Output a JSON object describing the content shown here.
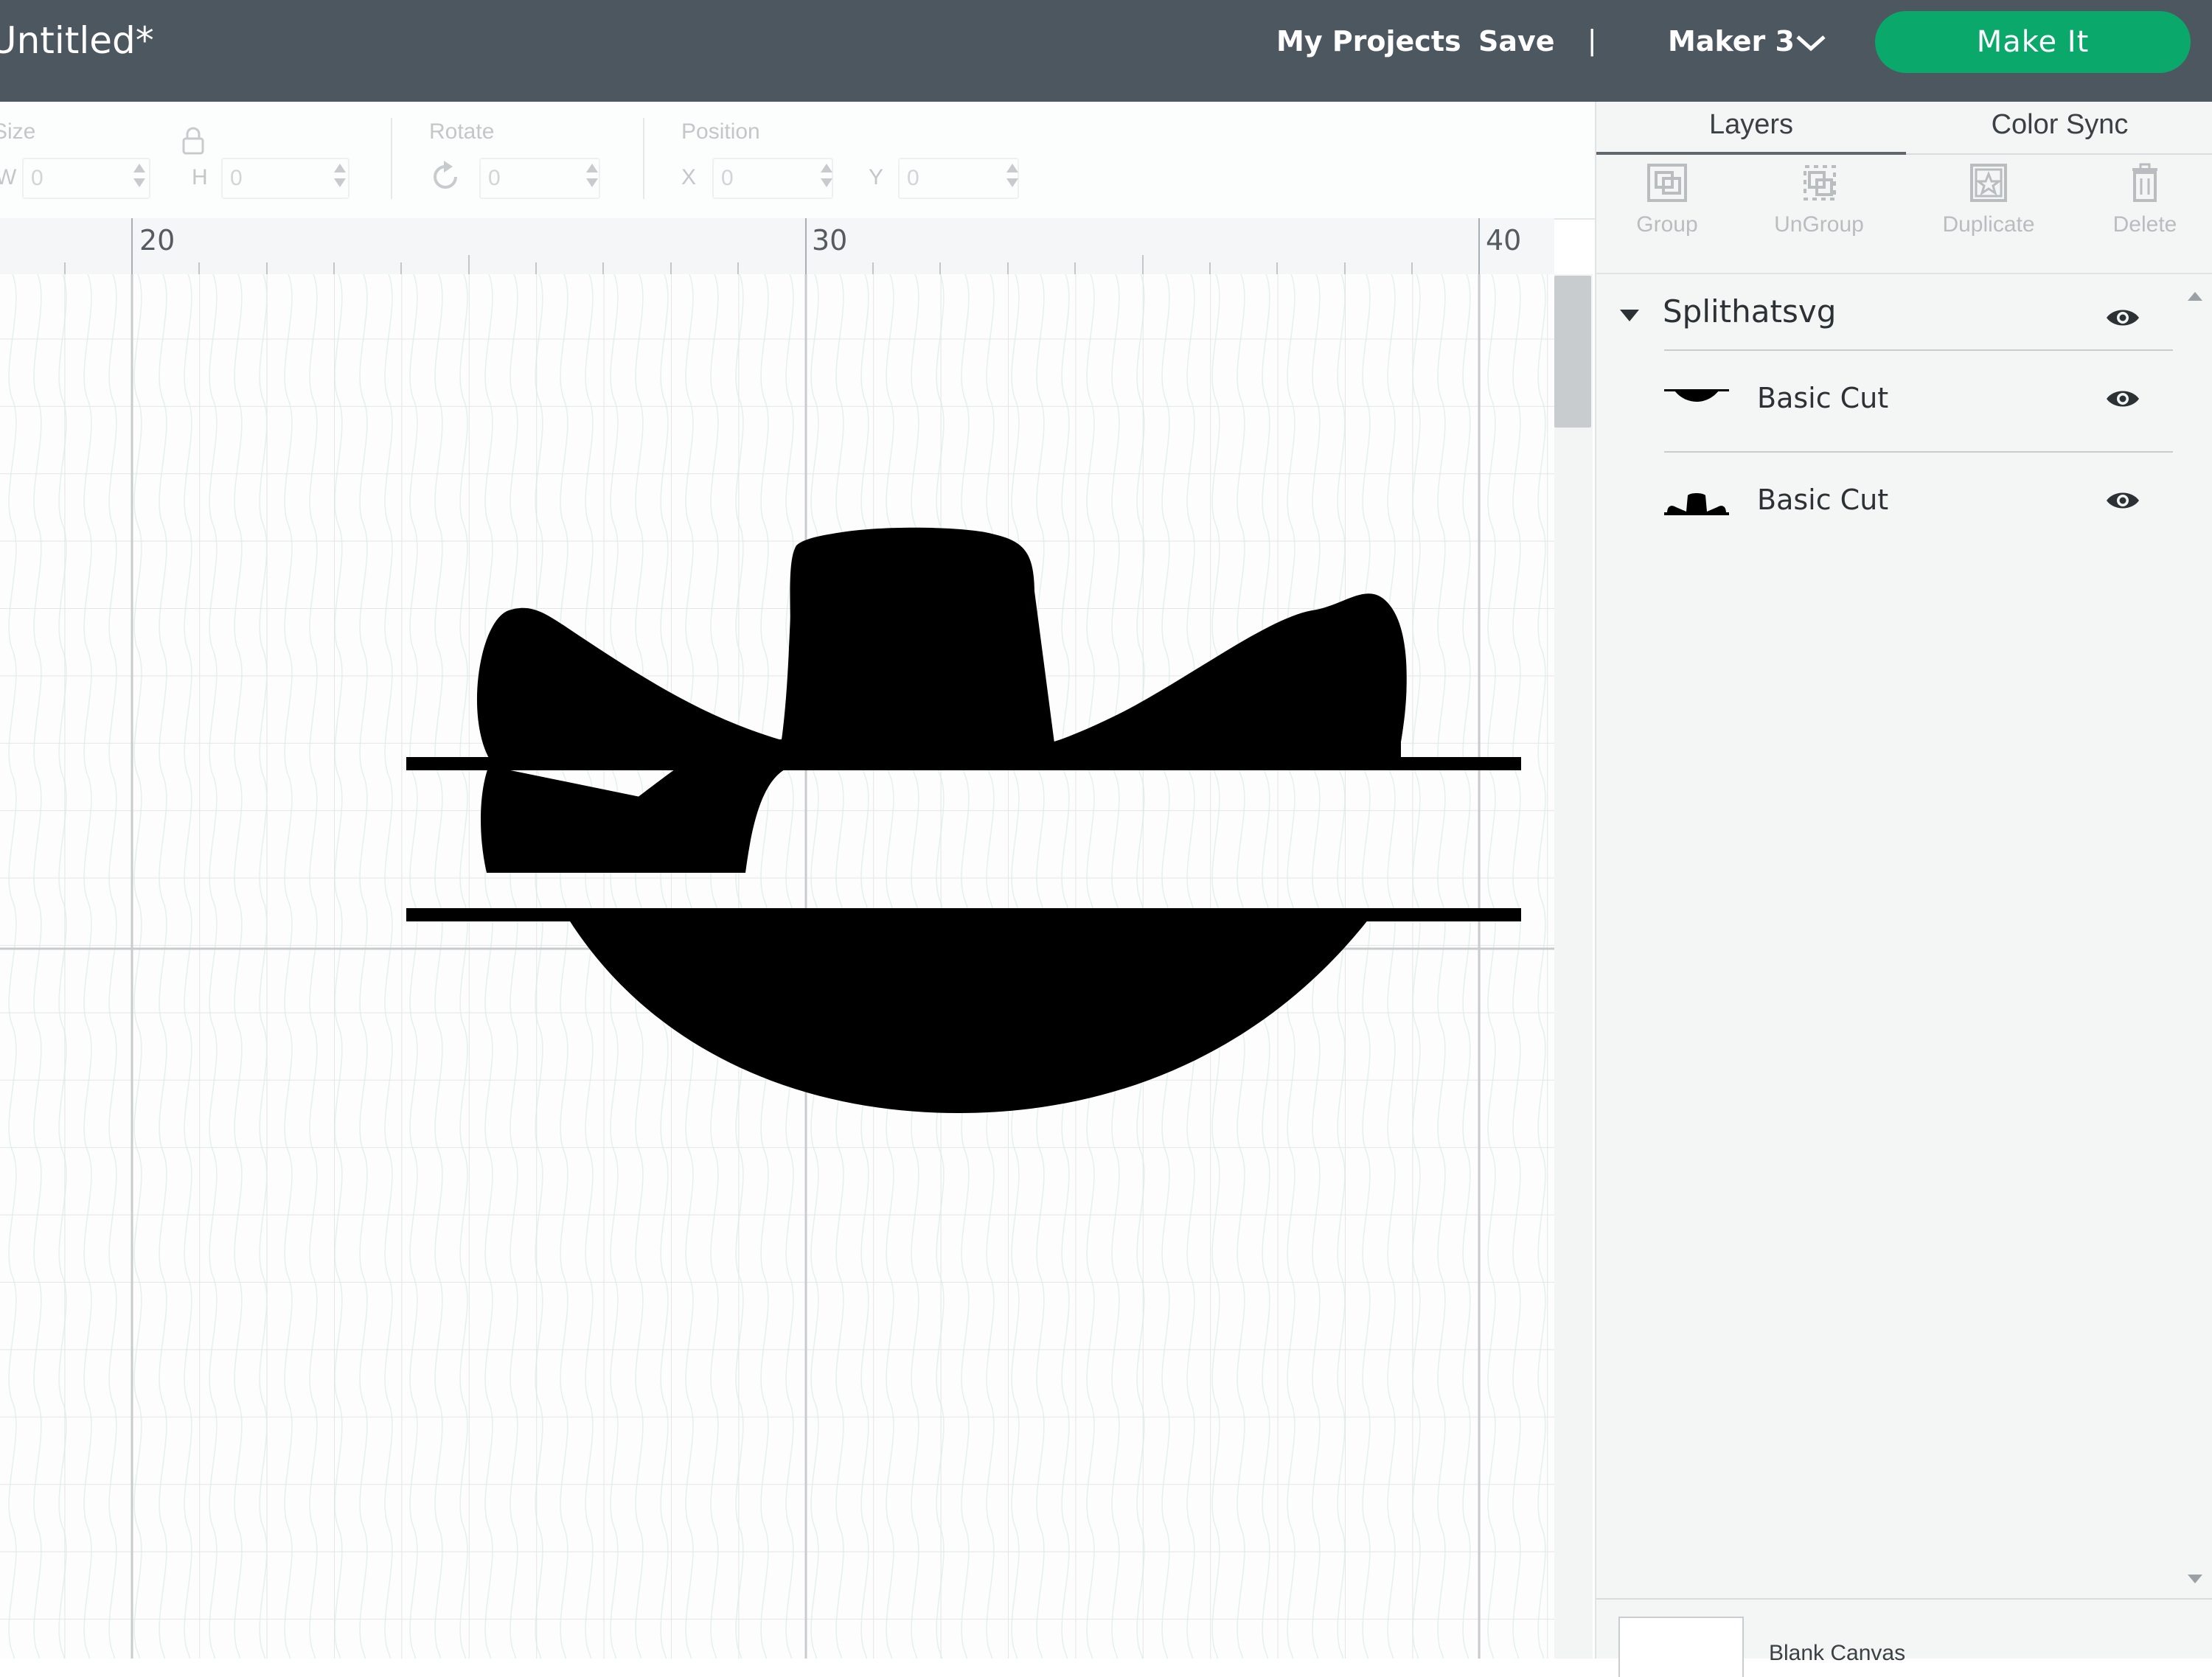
{
  "header": {
    "doc_title": "Untitled*",
    "my_projects": "My Projects",
    "save": "Save",
    "divider": "|",
    "machine": "Maker 3",
    "make_it": "Make It"
  },
  "toolbar": {
    "size_label": "Size",
    "w_label": "W",
    "w_value": "0",
    "h_label": "H",
    "h_value": "0",
    "rotate_label": "Rotate",
    "rotate_value": "0",
    "position_label": "Position",
    "x_label": "X",
    "x_value": "0",
    "y_label": "Y",
    "y_value": "0"
  },
  "ruler": {
    "ticks": [
      "20",
      "30",
      "40"
    ]
  },
  "panel": {
    "tabs": [
      "Layers",
      "Color Sync"
    ],
    "actions": {
      "group": "Group",
      "ungroup": "UnGroup",
      "duplicate": "Duplicate",
      "delete": "Delete"
    },
    "group_name": "Splithatsvg",
    "layers": [
      {
        "name": "Basic Cut",
        "thumb": "hat-bottom-thumbnail"
      },
      {
        "name": "Basic Cut",
        "thumb": "hat-top-thumbnail"
      }
    ],
    "blank_canvas": "Blank Canvas"
  },
  "colors": {
    "header_bg": "#4d5760",
    "make_it": "#0aa86b",
    "shape_fill": "#000000"
  }
}
